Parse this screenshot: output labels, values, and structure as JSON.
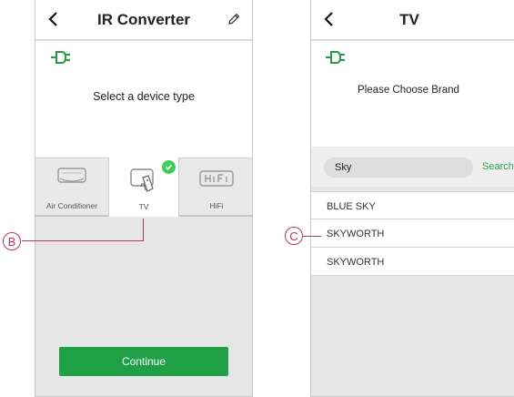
{
  "colors": {
    "accent_green": "#3dcd58",
    "button_green": "#1fa046",
    "callout": "#b5375b"
  },
  "left_screen": {
    "header": {
      "back_icon": "chevron-left-icon",
      "title": "IR Converter",
      "edit_icon": "pencil-icon"
    },
    "plug_icon": "plug-icon",
    "prompt": "Select a device type",
    "device_types": [
      {
        "label": "Air Conditioner",
        "icon": "air-conditioner-icon",
        "selected": false
      },
      {
        "label": "TV",
        "icon": "tv-remote-icon",
        "selected": true
      },
      {
        "label": "HiFi",
        "icon": "hifi-icon",
        "selected": false
      }
    ],
    "continue_label": "Continue",
    "callout_label": "B"
  },
  "right_screen": {
    "header": {
      "back_icon": "chevron-left-icon",
      "title": "TV"
    },
    "plug_icon": "plug-icon",
    "prompt": "Please Choose Brand",
    "search": {
      "value": "Sky",
      "button_label": "Search"
    },
    "brands": [
      "BLUE SKY",
      "SKYWORTH",
      "SKYWORTH"
    ],
    "callout_label": "C"
  }
}
